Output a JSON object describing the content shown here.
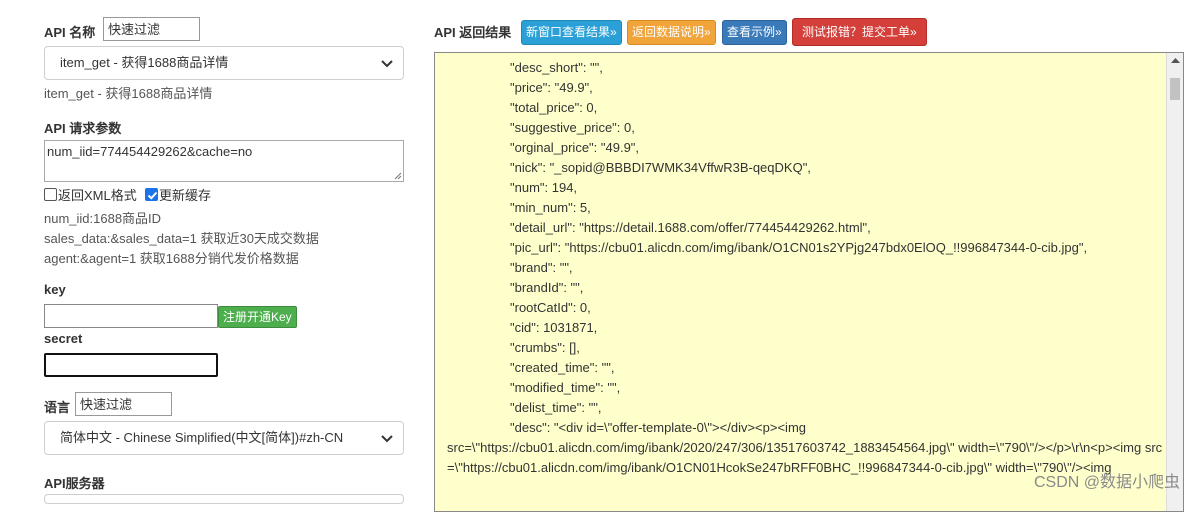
{
  "left": {
    "api_name_label": "API 名称",
    "filter1_placeholder": "快速过滤",
    "api_select_value": "item_get - 获得1688商品详情",
    "api_desc": "item_get - 获得1688商品详情",
    "params_label": "API 请求参数",
    "params_value": "num_iid=774454429262&cache=no",
    "xml_checkbox_label": "返回XML格式",
    "xml_checked": false,
    "cache_checkbox_label": "更新缓存",
    "cache_checked": true,
    "hints": [
      "num_iid:1688商品ID",
      "sales_data:&sales_data=1 获取近30天成交数据",
      "agent:&agent=1 获取1688分销代发价格数据"
    ],
    "key_label": "key",
    "register_button": "注册开通Key",
    "secret_label": "secret",
    "lang_label": "语言",
    "filter2_placeholder": "快速过滤",
    "lang_select_value": "简体中文 - Chinese Simplified(中文[简体])#zh-CN",
    "server_label": "API服务器"
  },
  "right": {
    "title": "API 返回结果",
    "btn_new_window": "新窗口查看结果»",
    "btn_return_desc": "返回数据说明»",
    "btn_example": "查看示例»",
    "btn_report": "测试报错？提交工单»",
    "code_lines": [
      "\"desc_short\": \"\",",
      "\"price\": \"49.9\",",
      "\"total_price\": 0,",
      "\"suggestive_price\": 0,",
      "\"orginal_price\": \"49.9\",",
      "\"nick\": \"_sopid@BBBDI7WMK34VffwR3B-qeqDKQ\",",
      "\"num\": 194,",
      "\"min_num\": 5,",
      "\"detail_url\": \"https://detail.1688.com/offer/774454429262.html\",",
      "\"pic_url\": \"https://cbu01.alicdn.com/img/ibank/O1CN01s2YPjg247bdx0ElOQ_!!996847344-0-cib.jpg\",",
      "\"brand\": \"\",",
      "\"brandId\": \"\",",
      "\"rootCatId\": 0,",
      "\"cid\": 1031871,",
      "\"crumbs\": [],",
      "\"created_time\": \"\",",
      "\"modified_time\": \"\",",
      "\"delist_time\": \"\",",
      "\"desc\": \"<div id=\\\"offer-template-0\\\"></div><p><img"
    ],
    "code_wrap": "src=\\\"https://cbu01.alicdn.com/img/ibank/2020/247/306/13517603742_1883454564.jpg\\\" width=\\\"790\\\"/></p>\\r\\n<p><img src=\\\"https://cbu01.alicdn.com/img/ibank/O1CN01HcokSe247bRFF0BHC_!!996847344-0-cib.jpg\\\" width=\\\"790\\\"/><img",
    "watermark": "CSDN @数据小爬虫"
  }
}
